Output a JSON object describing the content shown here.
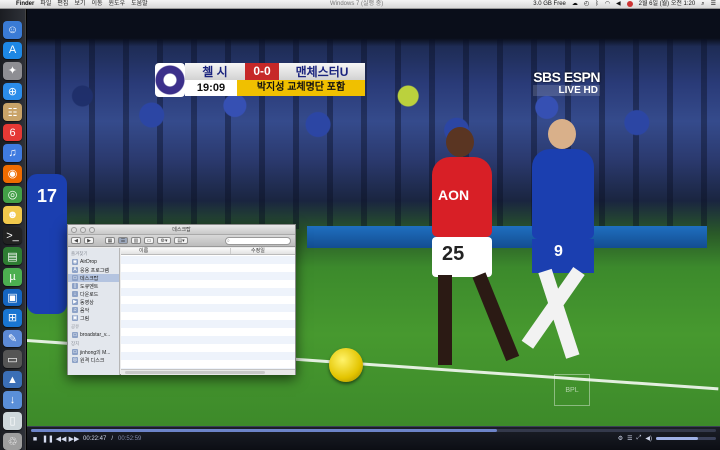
{
  "menubar": {
    "apple": "",
    "app": "Finder",
    "items": [
      "파일",
      "편집",
      "보기",
      "이동",
      "윈도우",
      "도움말"
    ],
    "window_title": "Windows 7 (실행 중)",
    "memory": "3.0 GB Free",
    "datetime": "2월 6일 (월) 오전 1:20"
  },
  "dock": {
    "items": [
      {
        "icon": "finder-icon",
        "glyph": "☺",
        "color": "#3a7bd5"
      },
      {
        "icon": "app-store-icon",
        "glyph": "A",
        "color": "#1e88e5"
      },
      {
        "icon": "launchpad-icon",
        "glyph": "✦",
        "color": "#8e8e93"
      },
      {
        "icon": "safari-icon",
        "glyph": "⊕",
        "color": "#2c8dea"
      },
      {
        "icon": "contacts-icon",
        "glyph": "☷",
        "color": "#c9a368"
      },
      {
        "icon": "calendar-icon",
        "glyph": "6",
        "color": "#e53935"
      },
      {
        "icon": "itunes-icon",
        "glyph": "♫",
        "color": "#3f7be0"
      },
      {
        "icon": "firefox-icon",
        "glyph": "◉",
        "color": "#ef6c00"
      },
      {
        "icon": "chrome-icon",
        "glyph": "◎",
        "color": "#43a047"
      },
      {
        "icon": "adium-icon",
        "glyph": "☻",
        "color": "#f2c94c"
      },
      {
        "icon": "terminal-icon",
        "glyph": ">_",
        "color": "#222222"
      },
      {
        "icon": "activity-monitor-icon",
        "glyph": "▤",
        "color": "#2e7d32"
      },
      {
        "icon": "utorrent-icon",
        "glyph": "µ",
        "color": "#4caf50"
      },
      {
        "icon": "virtualbox-icon",
        "glyph": "▣",
        "color": "#1565c0"
      },
      {
        "icon": "windows-icon",
        "glyph": "⊞",
        "color": "#1976d2"
      },
      {
        "icon": "preview-icon",
        "glyph": "✎",
        "color": "#5c8ad6"
      },
      {
        "icon": "screen-icon",
        "glyph": "▭",
        "color": "#555555"
      },
      {
        "icon": "app-folder-icon",
        "glyph": "▲",
        "color": "#3b6fb6"
      },
      {
        "icon": "downloads-folder-icon",
        "glyph": "↓",
        "color": "#5a8fd8"
      },
      {
        "icon": "document-icon",
        "glyph": "▯",
        "color": "#cfd8dc"
      },
      {
        "icon": "trash-icon",
        "glyph": "♲",
        "color": "#9e9e9e"
      }
    ]
  },
  "video": {
    "scoreboard": {
      "team_home": "첼 시",
      "score": "0-0",
      "team_away": "맨체스터U",
      "clock": "19:09",
      "ticker": "박지성 교체명단 포함"
    },
    "broadcaster": {
      "main": "SBS ESPN",
      "live": "LIVE HD"
    },
    "player_red_number": "25",
    "player_red_sponsor": "AON",
    "player_blue_number": "9",
    "player_left_number": "17",
    "corner_logo": "BPL"
  },
  "player_controls": {
    "time_current": "00:22:47",
    "time_total": "00:52:59",
    "progress": 0.68,
    "volume": 0.7
  },
  "finder": {
    "title": "데스크탑",
    "search_placeholder": "",
    "sections": [
      {
        "label": "즐겨찾기",
        "items": [
          {
            "label": "AirDrop",
            "icon": "airdrop-icon",
            "glyph": "◉",
            "selected": false
          },
          {
            "label": "응용 프로그램",
            "icon": "applications-icon",
            "glyph": "A",
            "selected": false
          },
          {
            "label": "데스크탑",
            "icon": "desktop-icon",
            "glyph": "▭",
            "selected": true
          },
          {
            "label": "도큐멘트",
            "icon": "documents-icon",
            "glyph": "▯",
            "selected": false
          },
          {
            "label": "다운로드",
            "icon": "downloads-icon",
            "glyph": "↓",
            "selected": false
          },
          {
            "label": "동영상",
            "icon": "movies-icon",
            "glyph": "▶",
            "selected": false
          },
          {
            "label": "음악",
            "icon": "music-icon",
            "glyph": "♫",
            "selected": false
          },
          {
            "label": "그림",
            "icon": "pictures-icon",
            "glyph": "▣",
            "selected": false
          }
        ]
      },
      {
        "label": "공유",
        "items": [
          {
            "label": "broadstar_v...",
            "icon": "shared-computer-icon",
            "glyph": "▭",
            "selected": false
          }
        ]
      },
      {
        "label": "장치",
        "items": [
          {
            "label": "jinhong의 M...",
            "icon": "computer-icon",
            "glyph": "▭",
            "selected": false
          },
          {
            "label": "원격 디스크",
            "icon": "remote-disc-icon",
            "glyph": "◎",
            "selected": false
          }
        ]
      }
    ],
    "columns": {
      "name": "이름",
      "modified": "수정일"
    }
  }
}
